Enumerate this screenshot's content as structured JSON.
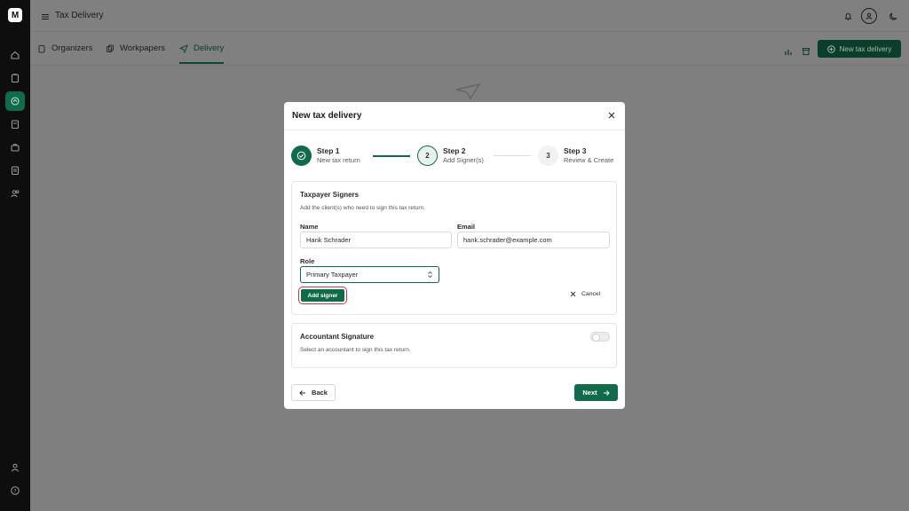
{
  "app": {
    "logo_text": "M"
  },
  "topbar": {
    "title": "Tax Delivery"
  },
  "tabs": [
    {
      "label": "Organizers"
    },
    {
      "label": "Workpapers"
    },
    {
      "label": "Delivery"
    }
  ],
  "actions": {
    "new_tax_delivery": "New tax delivery"
  },
  "modal": {
    "title": "New tax delivery",
    "steps": [
      {
        "title": "Step 1",
        "subtitle": "New tax return",
        "number": "1",
        "state": "complete"
      },
      {
        "title": "Step 2",
        "subtitle": "Add Signer(s)",
        "number": "2",
        "state": "active"
      },
      {
        "title": "Step 3",
        "subtitle": "Review & Create",
        "number": "3",
        "state": "pending"
      }
    ],
    "taxpayer": {
      "title": "Taxpayer Signers",
      "description": "Add the client(s) who need to sign this tax return.",
      "name_label": "Name",
      "name_value": "Hank Schrader",
      "email_label": "Email",
      "email_value": "hank.schrader@example.com",
      "role_label": "Role",
      "role_value": "Primary Taxpayer",
      "add_signer": "Add signer",
      "cancel": "Cancel"
    },
    "accountant": {
      "title": "Accountant Signature",
      "description": "Select an accountant to sign this tax return.",
      "toggle_on": false
    },
    "back": "Back",
    "next": "Next"
  },
  "colors": {
    "brand": "#0f6b4a",
    "overlay": "#7f7f7f",
    "rail": "#0e0e0e"
  }
}
